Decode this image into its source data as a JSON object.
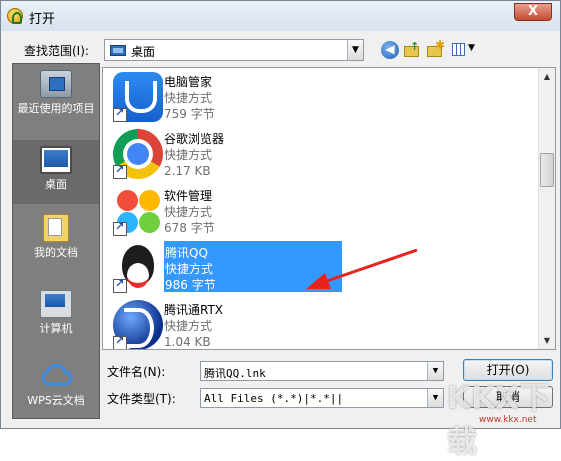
{
  "window": {
    "title": "打开",
    "close_label": "X"
  },
  "toolbar": {
    "look_in_label": "查找范围(I):",
    "look_in_value": "桌面",
    "back_glyph": "◀",
    "view_menu_glyph": "▼"
  },
  "places": [
    {
      "label": "最近使用的项目",
      "icon": "recent-items-icon"
    },
    {
      "label": "桌面",
      "icon": "desktop-icon",
      "selected": true
    },
    {
      "label": "我的文档",
      "icon": "documents-folder-icon"
    },
    {
      "label": "计算机",
      "icon": "computer-icon"
    },
    {
      "label": "WPS云文档",
      "icon": "wps-cloud-icon"
    }
  ],
  "files": [
    {
      "name": "电脑管家",
      "type": "快捷方式",
      "size": "759 字节",
      "icon": "tencent-pc-manager-icon"
    },
    {
      "name": "谷歌浏览器",
      "type": "快捷方式",
      "size": "2.17 KB",
      "icon": "chrome-icon"
    },
    {
      "name": "软件管理",
      "type": "快捷方式",
      "size": "678 字节",
      "icon": "software-manager-icon"
    },
    {
      "name": "腾讯QQ",
      "type": "快捷方式",
      "size": "986 字节",
      "icon": "qq-penguin-icon",
      "selected": true
    },
    {
      "name": "腾讯通RTX",
      "type": "快捷方式",
      "size": "1.04 KB",
      "icon": "rtx-icon"
    }
  ],
  "footer": {
    "filename_label": "文件名(N):",
    "filename_value": "腾讯QQ.lnk",
    "filetype_label": "文件类型(T):",
    "filetype_value": "All Files (*.*)|*.*||",
    "open_label": "打开(O)",
    "cancel_label": "取消"
  },
  "watermark": {
    "text": "KKX下载",
    "url": "www.kkx.net"
  },
  "colors": {
    "selection": "#3399ff",
    "places_bg": "#7f7f7f",
    "annotation_arrow": "#e8231c"
  }
}
